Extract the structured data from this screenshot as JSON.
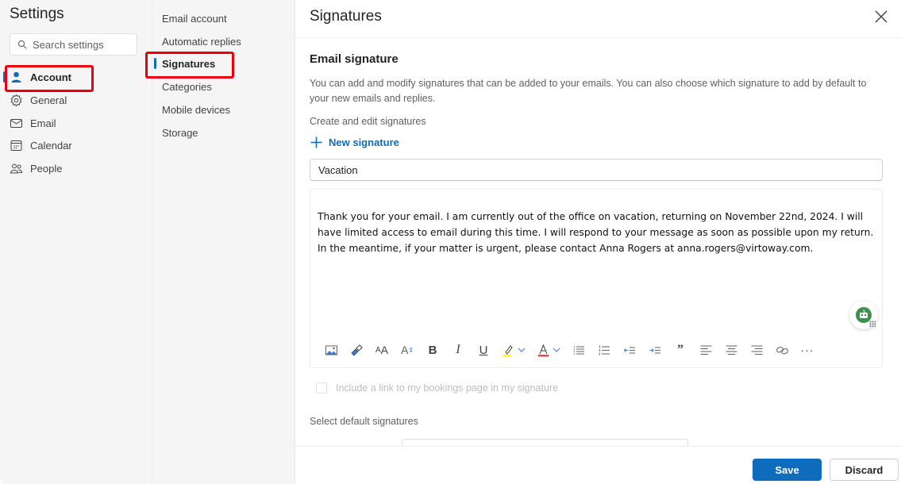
{
  "settings": {
    "title": "Settings",
    "search_placeholder": "Search settings",
    "categories": [
      {
        "label": "Account",
        "icon": "person-icon",
        "active": true
      },
      {
        "label": "General",
        "icon": "gear-icon",
        "active": false
      },
      {
        "label": "Email",
        "icon": "mail-icon",
        "active": false
      },
      {
        "label": "Calendar",
        "icon": "calendar-icon",
        "active": false
      },
      {
        "label": "People",
        "icon": "people-icon",
        "active": false
      }
    ]
  },
  "account_nav": {
    "items": [
      {
        "label": "Email account",
        "active": false
      },
      {
        "label": "Automatic replies",
        "active": false
      },
      {
        "label": "Signatures",
        "active": true
      },
      {
        "label": "Categories",
        "active": false
      },
      {
        "label": "Mobile devices",
        "active": false
      },
      {
        "label": "Storage",
        "active": false
      }
    ]
  },
  "main": {
    "title": "Signatures",
    "close_icon": "close-icon",
    "section_title": "Email signature",
    "description": "You can add and modify signatures that can be added to your emails. You can also choose which signature to add by default to your new emails and replies.",
    "create_label": "Create and edit signatures",
    "new_signature_label": "New signature",
    "signature_name": "Vacation",
    "signature_body": "Thank you for your email. I am currently out of the office on vacation, returning on November 22nd, 2024. I will have limited access to email during this time. I will respond to your message as soon as possible upon my return. In the meantime, if your matter is urgent, please contact Anna Rogers at anna.rogers@virtoway.com.",
    "toolbar": [
      "insert-picture-icon",
      "format-painter-icon",
      "font-size-icon",
      "superscript-icon",
      "bold-icon",
      "italic-icon",
      "underline-icon",
      "highlight-icon",
      "font-color-icon",
      "bullets-icon",
      "numbering-icon",
      "decrease-indent-icon",
      "increase-indent-icon",
      "quote-icon",
      "align-left-icon",
      "align-center-icon",
      "align-right-icon",
      "link-icon",
      "more-options-icon"
    ],
    "bookings_checkbox_label": "Include a link to my bookings page in my signature",
    "bookings_checked": false,
    "default_signatures_label": "Select default signatures",
    "save_label": "Save",
    "discard_label": "Discard"
  },
  "colors": {
    "accent": "#0f6cbd",
    "highlight_marker": "#ffff00",
    "font_color_marker": "#e8474b",
    "annotation_red": "#e8000b"
  }
}
